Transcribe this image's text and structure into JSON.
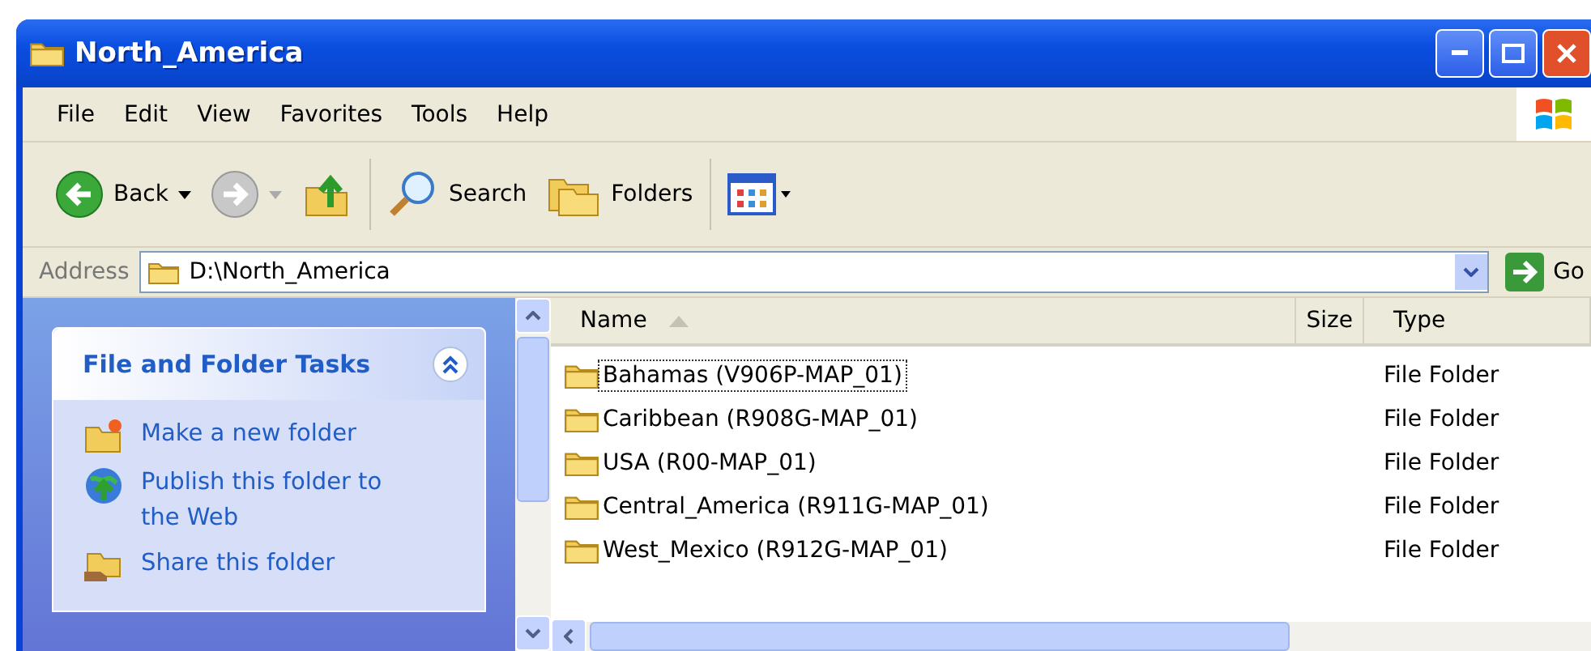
{
  "window": {
    "title": "North_America"
  },
  "menu": [
    "File",
    "Edit",
    "View",
    "Favorites",
    "Tools",
    "Help"
  ],
  "toolbar": [
    {
      "kind": "back",
      "label": "Back",
      "disabled": false
    },
    {
      "kind": "forward",
      "disabled": true
    },
    {
      "kind": "up"
    },
    {
      "kind": "search",
      "label": "Search"
    },
    {
      "kind": "folders",
      "label": "Folders"
    },
    {
      "kind": "views"
    }
  ],
  "address": {
    "label": "Address",
    "value": "D:\\North_America",
    "go": "Go"
  },
  "task_panel": {
    "title": "File and Folder Tasks",
    "expanded": true,
    "items": [
      {
        "kind": "new",
        "label": "Make a new folder"
      },
      {
        "kind": "publish",
        "label": "Publish this folder to the Web"
      },
      {
        "kind": "share",
        "label": "Share this folder"
      }
    ]
  },
  "table": {
    "columns": [
      {
        "label": "Name",
        "sorted": true
      },
      {
        "label": "Size",
        "sorted": false
      },
      {
        "label": "Type",
        "sorted": false
      }
    ],
    "rows": [
      {
        "name": "Bahamas (V906P-MAP_01)",
        "type": "File Folder",
        "focused": true
      },
      {
        "name": "Caribbean (R908G-MAP_01)",
        "type": "File Folder",
        "focused": false
      },
      {
        "name": "USA (R00-MAP_01)",
        "type": "File Folder",
        "focused": false
      },
      {
        "name": "Central_America (R911G-MAP_01)",
        "type": "File Folder",
        "focused": false
      },
      {
        "name": "West_Mexico (R912G-MAP_01)",
        "type": "File Folder",
        "focused": false
      }
    ]
  }
}
